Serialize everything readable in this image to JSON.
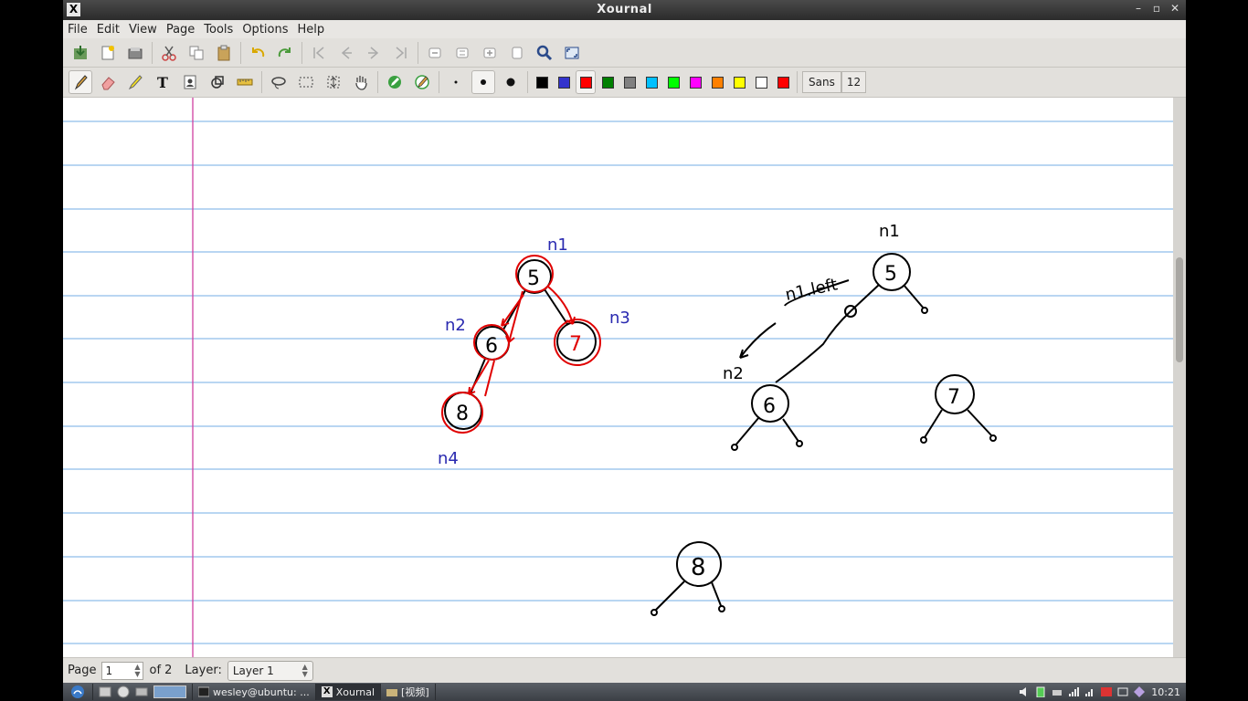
{
  "window": {
    "title": "Xournal"
  },
  "menu": [
    "File",
    "Edit",
    "View",
    "Page",
    "Tools",
    "Options",
    "Help"
  ],
  "toolbar2": {
    "font_name": "Sans",
    "font_size": "12"
  },
  "colors": [
    "#000000",
    "#3333cc",
    "#ff0000",
    "#008000",
    "#808080",
    "#00c0ff",
    "#00ff00",
    "#ff00ff",
    "#ff8000",
    "#ffff00",
    "#ffffff",
    "#ff0000"
  ],
  "status": {
    "page_label": "Page",
    "page_value": "1",
    "of_label": "of 2",
    "layer_label": "Layer:",
    "layer_value": "Layer 1"
  },
  "taskbar": {
    "items": [
      "wesley@ubuntu: ...",
      "Xournal",
      "[视频]"
    ],
    "clock": "10:21"
  },
  "sketch": {
    "left_labels": [
      "n1",
      "n2",
      "n3",
      "n4"
    ],
    "left_nodes": [
      "5",
      "6",
      "7",
      "8"
    ],
    "right_labels": [
      "n1",
      "n1.left",
      "n2"
    ],
    "right_nodes": [
      "5",
      "6",
      "7",
      "8"
    ]
  }
}
